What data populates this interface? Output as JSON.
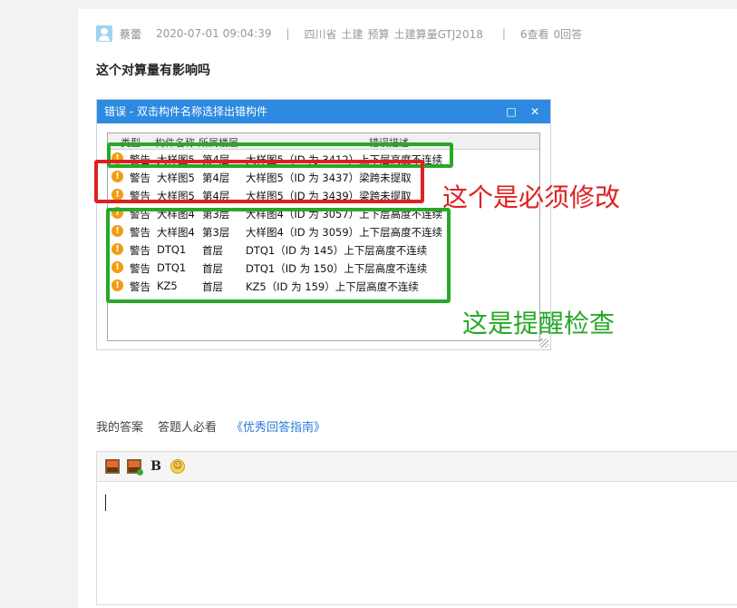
{
  "post": {
    "username": "蔡蕾",
    "datetime": "2020-07-01 09:04:39",
    "separator": "|",
    "province": "四川省",
    "tags": [
      "土建",
      "预算",
      "土建算量GTJ2018"
    ],
    "views": "6查看",
    "answers": "0回答",
    "question_title": "这个对算量有影响吗"
  },
  "screenshot": {
    "dialog_title": "错误 - 双击构件名称选择出错构件",
    "maximize_glyph": "□",
    "close_glyph": "✕",
    "columns": [
      "类型",
      "构件名称",
      "所属楼层",
      "错误描述"
    ],
    "rows": [
      {
        "type": "警告",
        "name": "大样图5",
        "floor": "第4层",
        "desc": "大样图5（ID 为 3412）上下层高度不连续"
      },
      {
        "type": "警告",
        "name": "大样图5",
        "floor": "第4层",
        "desc": "大样图5（ID 为 3437）梁跨未提取"
      },
      {
        "type": "警告",
        "name": "大样图5",
        "floor": "第4层",
        "desc": "大样图5（ID 为 3439）梁跨未提取"
      },
      {
        "type": "警告",
        "name": "大样图4",
        "floor": "第3层",
        "desc": "大样图4（ID 为 3057）上下层高度不连续"
      },
      {
        "type": "警告",
        "name": "大样图4",
        "floor": "第3层",
        "desc": "大样图4（ID 为 3059）上下层高度不连续"
      },
      {
        "type": "警告",
        "name": "DTQ1",
        "floor": "首层",
        "desc": "DTQ1（ID 为 145）上下层高度不连续"
      },
      {
        "type": "警告",
        "name": "DTQ1",
        "floor": "首层",
        "desc": "DTQ1（ID 为 150）上下层高度不连续"
      },
      {
        "type": "警告",
        "name": "KZ5",
        "floor": "首层",
        "desc": "KZ5（ID 为 159）上下层高度不连续"
      }
    ],
    "annotation_red": "这个是必须修改",
    "annotation_green": "这是提醒检查",
    "colors": {
      "red": "#e02020",
      "green": "#28a828",
      "warning": "#f39c12",
      "titlebar": "#2d8ae0"
    }
  },
  "answer": {
    "tab_my_answer": "我的答案",
    "tab_must_read": "答题人必看",
    "tab_guide_link": "《优秀回答指南》",
    "toolbar": [
      "image-icon",
      "image-upload-icon",
      "bold-icon",
      "emoji-icon"
    ],
    "bold_label": "B",
    "emoji_glyph": "☺"
  }
}
